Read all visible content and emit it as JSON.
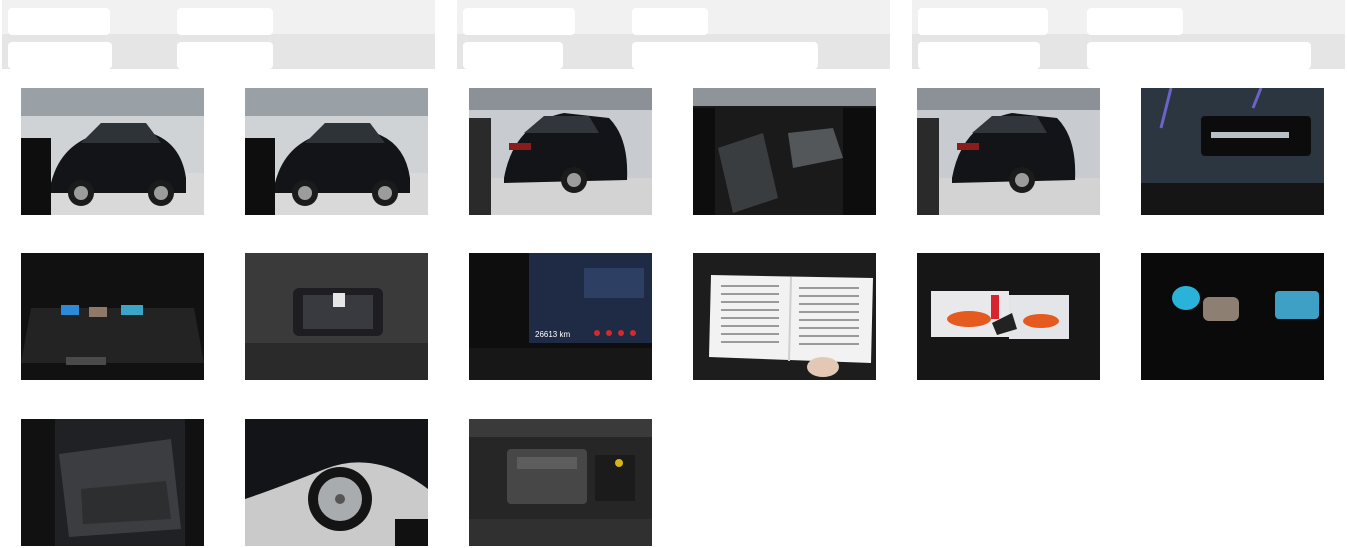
{
  "photos": [
    {
      "col": 0,
      "row": 0,
      "subject": "car-front-exterior",
      "label": ""
    },
    {
      "col": 1,
      "row": 0,
      "subject": "car-front-exterior",
      "label": ""
    },
    {
      "col": 2,
      "row": 0,
      "subject": "car-rear-exterior",
      "label": ""
    },
    {
      "col": 3,
      "row": 0,
      "subject": "front-interior-seats",
      "label": ""
    },
    {
      "col": 4,
      "row": 0,
      "subject": "car-rear-exterior",
      "label": ""
    },
    {
      "col": 5,
      "row": 0,
      "subject": "door-sill-plate",
      "label": ""
    },
    {
      "col": 0,
      "row": 1,
      "subject": "trunk-interior",
      "label": ""
    },
    {
      "col": 1,
      "row": 1,
      "subject": "instrument-cluster",
      "label": ""
    },
    {
      "col": 2,
      "row": 1,
      "subject": "dashboard-mileage",
      "label": "26613 km"
    },
    {
      "col": 3,
      "row": 1,
      "subject": "service-booklet",
      "label": ""
    },
    {
      "col": 4,
      "row": 1,
      "subject": "brochures-and-key",
      "label": ""
    },
    {
      "col": 5,
      "row": 1,
      "subject": "keys-and-accessories",
      "label": ""
    },
    {
      "col": 0,
      "row": 2,
      "subject": "rear-seats-interior",
      "label": ""
    },
    {
      "col": 1,
      "row": 2,
      "subject": "front-wheel-closeup",
      "label": ""
    },
    {
      "col": 2,
      "row": 2,
      "subject": "engine-bay",
      "label": ""
    }
  ],
  "colors": {
    "header_bg": "#f1f1f1",
    "header_stripe": "#e5e5e5",
    "car_body": "#121418",
    "garage_floor": "#d9d9d9"
  }
}
